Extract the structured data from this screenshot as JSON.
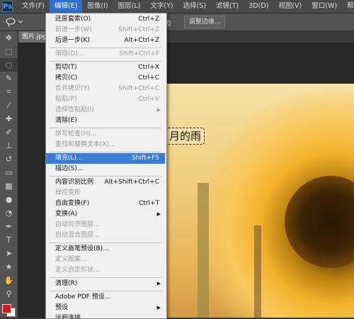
{
  "app": {
    "logo": "Ps"
  },
  "menubar": {
    "items": [
      {
        "label": "文件(F)"
      },
      {
        "label": "编辑(E)",
        "active": true
      },
      {
        "label": "图像(I)"
      },
      {
        "label": "图层(L)"
      },
      {
        "label": "文字(Y)"
      },
      {
        "label": "选择(S)"
      },
      {
        "label": "滤镜(T)"
      },
      {
        "label": "3D(D)"
      },
      {
        "label": "视图(V)"
      },
      {
        "label": "窗口(W)"
      },
      {
        "label": "帮助(H)"
      }
    ]
  },
  "options_bar": {
    "trailing_text": "齿",
    "refine_edge_label": "调整边缘..."
  },
  "document_tab": {
    "label": "图片.jpg"
  },
  "canvas": {
    "text": "月的雨"
  },
  "tools": [
    "move-icon",
    "marquee-icon",
    "lasso-icon",
    "quick-select-icon",
    "crop-icon",
    "eyedropper-icon",
    "healing-icon",
    "brush-icon",
    "stamp-icon",
    "history-brush-icon",
    "eraser-icon",
    "gradient-icon",
    "blur-icon",
    "dodge-icon",
    "pen-icon",
    "type-icon",
    "path-select-icon",
    "shape-icon",
    "hand-icon",
    "zoom-icon"
  ],
  "colors": {
    "foreground": "#d01818",
    "background": "#ffffff",
    "menu_highlight": "#3a7bd5"
  },
  "edit_menu": {
    "items": [
      {
        "label": "还原套索(O)",
        "shortcut": "Ctrl+Z"
      },
      {
        "label": "前进一步(W)",
        "shortcut": "Shift+Ctrl+Z",
        "disabled": true
      },
      {
        "label": "后退一步(K)",
        "shortcut": "Alt+Ctrl+Z"
      },
      {
        "label": "渐隐(D)...",
        "shortcut": "Shift+Ctrl+F",
        "disabled": true
      },
      {
        "label": "剪切(T)",
        "shortcut": "Ctrl+X"
      },
      {
        "label": "拷贝(C)",
        "shortcut": "Ctrl+C"
      },
      {
        "label": "合并拷贝(Y)",
        "shortcut": "Shift+Ctrl+C",
        "disabled": true
      },
      {
        "label": "粘贴(P)",
        "shortcut": "Ctrl+V",
        "disabled": true
      },
      {
        "label": "选择性粘贴(I)",
        "shortcut": "",
        "disabled": true,
        "submenu": true
      },
      {
        "label": "清除(E)",
        "shortcut": ""
      },
      {
        "label": "拼写检查(H)...",
        "shortcut": "",
        "disabled": true
      },
      {
        "label": "查找和替换文本(X)...",
        "shortcut": "",
        "disabled": true
      },
      {
        "label": "填充(L)...",
        "shortcut": "Shift+F5",
        "highlighted": true
      },
      {
        "label": "描边(S)...",
        "shortcut": ""
      },
      {
        "label": "内容识别比例",
        "shortcut": "Alt+Shift+Ctrl+C"
      },
      {
        "label": "操控变形",
        "shortcut": "",
        "disabled": true
      },
      {
        "label": "自由变换(F)",
        "shortcut": "Ctrl+T"
      },
      {
        "label": "变换(A)",
        "shortcut": "",
        "submenu": true
      },
      {
        "label": "自动对齐图层...",
        "shortcut": "",
        "disabled": true
      },
      {
        "label": "自动混合图层...",
        "shortcut": "",
        "disabled": true
      },
      {
        "label": "定义画笔预设(B)...",
        "shortcut": ""
      },
      {
        "label": "定义图案...",
        "shortcut": "",
        "disabled": true
      },
      {
        "label": "定义自定形状...",
        "shortcut": "",
        "disabled": true
      },
      {
        "label": "清理(R)",
        "shortcut": "",
        "submenu": true
      },
      {
        "label": "Adobe PDF 预设...",
        "shortcut": ""
      },
      {
        "label": "预设",
        "shortcut": "",
        "submenu": true
      },
      {
        "label": "远程连接...",
        "shortcut": ""
      }
    ]
  }
}
